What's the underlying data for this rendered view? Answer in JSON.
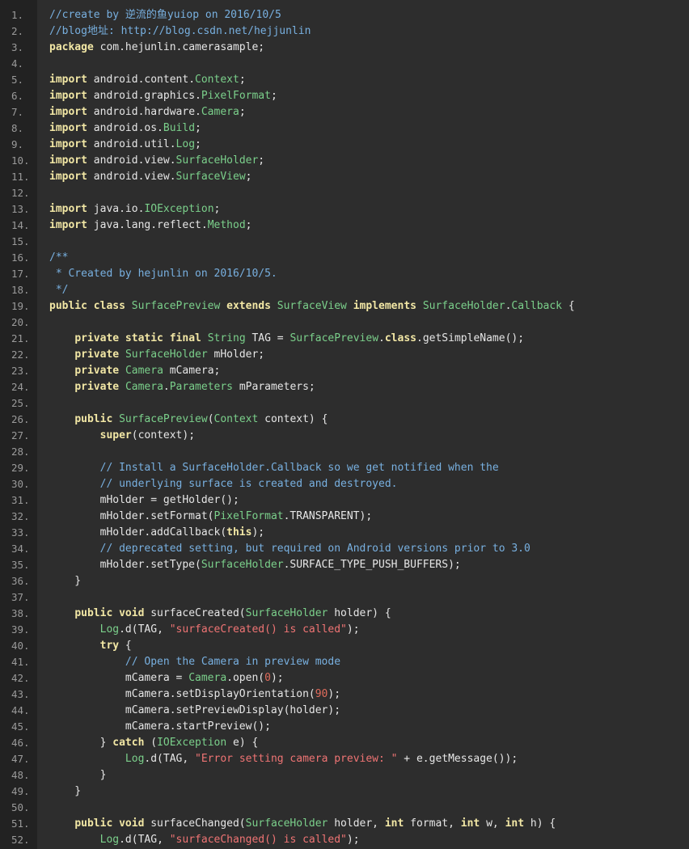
{
  "colors": {
    "gutter_background": "#222222",
    "code_background": "#2d2d2d",
    "line_number": "#9a9a9a",
    "plain": "#e6e6e6",
    "keyword": "#f2e7a5",
    "type": "#7bd08b",
    "comment": "#78b0e0",
    "string": "#ef7474",
    "number": "#e06c5c"
  },
  "code": {
    "lines": [
      {
        "number": "1.",
        "tokens": [
          {
            "t": "cm",
            "v": "//create by 逆流的鱼yuiop on 2016/10/5"
          }
        ]
      },
      {
        "number": "2.",
        "tokens": [
          {
            "t": "cm",
            "v": "//blog地址: http://blog.csdn.net/hejjunlin"
          }
        ]
      },
      {
        "number": "3.",
        "tokens": [
          {
            "t": "kw",
            "v": "package"
          },
          {
            "t": "pl",
            "v": " com.hejunlin.camerasample;"
          }
        ]
      },
      {
        "number": "4.",
        "tokens": []
      },
      {
        "number": "5.",
        "tokens": [
          {
            "t": "kw",
            "v": "import"
          },
          {
            "t": "pl",
            "v": " android.content."
          },
          {
            "t": "ty",
            "v": "Context"
          },
          {
            "t": "pl",
            "v": ";"
          }
        ]
      },
      {
        "number": "6.",
        "tokens": [
          {
            "t": "kw",
            "v": "import"
          },
          {
            "t": "pl",
            "v": " android.graphics."
          },
          {
            "t": "ty",
            "v": "PixelFormat"
          },
          {
            "t": "pl",
            "v": ";"
          }
        ]
      },
      {
        "number": "7.",
        "tokens": [
          {
            "t": "kw",
            "v": "import"
          },
          {
            "t": "pl",
            "v": " android.hardware."
          },
          {
            "t": "ty",
            "v": "Camera"
          },
          {
            "t": "pl",
            "v": ";"
          }
        ]
      },
      {
        "number": "8.",
        "tokens": [
          {
            "t": "kw",
            "v": "import"
          },
          {
            "t": "pl",
            "v": " android.os."
          },
          {
            "t": "ty",
            "v": "Build"
          },
          {
            "t": "pl",
            "v": ";"
          }
        ]
      },
      {
        "number": "9.",
        "tokens": [
          {
            "t": "kw",
            "v": "import"
          },
          {
            "t": "pl",
            "v": " android.util."
          },
          {
            "t": "ty",
            "v": "Log"
          },
          {
            "t": "pl",
            "v": ";"
          }
        ]
      },
      {
        "number": "10.",
        "tokens": [
          {
            "t": "kw",
            "v": "import"
          },
          {
            "t": "pl",
            "v": " android.view."
          },
          {
            "t": "ty",
            "v": "SurfaceHolder"
          },
          {
            "t": "pl",
            "v": ";"
          }
        ]
      },
      {
        "number": "11.",
        "tokens": [
          {
            "t": "kw",
            "v": "import"
          },
          {
            "t": "pl",
            "v": " android.view."
          },
          {
            "t": "ty",
            "v": "SurfaceView"
          },
          {
            "t": "pl",
            "v": ";"
          }
        ]
      },
      {
        "number": "12.",
        "tokens": []
      },
      {
        "number": "13.",
        "tokens": [
          {
            "t": "kw",
            "v": "import"
          },
          {
            "t": "pl",
            "v": " java.io."
          },
          {
            "t": "ty",
            "v": "IOException"
          },
          {
            "t": "pl",
            "v": ";"
          }
        ]
      },
      {
        "number": "14.",
        "tokens": [
          {
            "t": "kw",
            "v": "import"
          },
          {
            "t": "pl",
            "v": " java.lang.reflect."
          },
          {
            "t": "ty",
            "v": "Method"
          },
          {
            "t": "pl",
            "v": ";"
          }
        ]
      },
      {
        "number": "15.",
        "tokens": []
      },
      {
        "number": "16.",
        "tokens": [
          {
            "t": "cm",
            "v": "/**"
          }
        ]
      },
      {
        "number": "17.",
        "tokens": [
          {
            "t": "cm",
            "v": " * Created by hejunlin on 2016/10/5."
          }
        ]
      },
      {
        "number": "18.",
        "tokens": [
          {
            "t": "cm",
            "v": " */"
          }
        ]
      },
      {
        "number": "19.",
        "tokens": [
          {
            "t": "kw",
            "v": "public class"
          },
          {
            "t": "pl",
            "v": " "
          },
          {
            "t": "ty",
            "v": "SurfacePreview"
          },
          {
            "t": "pl",
            "v": " "
          },
          {
            "t": "kw",
            "v": "extends"
          },
          {
            "t": "pl",
            "v": " "
          },
          {
            "t": "ty",
            "v": "SurfaceView"
          },
          {
            "t": "pl",
            "v": " "
          },
          {
            "t": "kw",
            "v": "implements"
          },
          {
            "t": "pl",
            "v": " "
          },
          {
            "t": "ty",
            "v": "SurfaceHolder"
          },
          {
            "t": "pl",
            "v": "."
          },
          {
            "t": "ty",
            "v": "Callback"
          },
          {
            "t": "pl",
            "v": " {"
          }
        ]
      },
      {
        "number": "20.",
        "tokens": []
      },
      {
        "number": "21.",
        "tokens": [
          {
            "t": "pl",
            "v": "    "
          },
          {
            "t": "kw",
            "v": "private static final"
          },
          {
            "t": "pl",
            "v": " "
          },
          {
            "t": "ty",
            "v": "String"
          },
          {
            "t": "pl",
            "v": " TAG = "
          },
          {
            "t": "ty",
            "v": "SurfacePreview"
          },
          {
            "t": "pl",
            "v": "."
          },
          {
            "t": "kw",
            "v": "class"
          },
          {
            "t": "pl",
            "v": ".getSimpleName();"
          }
        ]
      },
      {
        "number": "22.",
        "tokens": [
          {
            "t": "pl",
            "v": "    "
          },
          {
            "t": "kw",
            "v": "private"
          },
          {
            "t": "pl",
            "v": " "
          },
          {
            "t": "ty",
            "v": "SurfaceHolder"
          },
          {
            "t": "pl",
            "v": " mHolder;"
          }
        ]
      },
      {
        "number": "23.",
        "tokens": [
          {
            "t": "pl",
            "v": "    "
          },
          {
            "t": "kw",
            "v": "private"
          },
          {
            "t": "pl",
            "v": " "
          },
          {
            "t": "ty",
            "v": "Camera"
          },
          {
            "t": "pl",
            "v": " mCamera;"
          }
        ]
      },
      {
        "number": "24.",
        "tokens": [
          {
            "t": "pl",
            "v": "    "
          },
          {
            "t": "kw",
            "v": "private"
          },
          {
            "t": "pl",
            "v": " "
          },
          {
            "t": "ty",
            "v": "Camera"
          },
          {
            "t": "pl",
            "v": "."
          },
          {
            "t": "ty",
            "v": "Parameters"
          },
          {
            "t": "pl",
            "v": " mParameters;"
          }
        ]
      },
      {
        "number": "25.",
        "tokens": []
      },
      {
        "number": "26.",
        "tokens": [
          {
            "t": "pl",
            "v": "    "
          },
          {
            "t": "kw",
            "v": "public"
          },
          {
            "t": "pl",
            "v": " "
          },
          {
            "t": "ty",
            "v": "SurfacePreview"
          },
          {
            "t": "pl",
            "v": "("
          },
          {
            "t": "ty",
            "v": "Context"
          },
          {
            "t": "pl",
            "v": " context) {"
          }
        ]
      },
      {
        "number": "27.",
        "tokens": [
          {
            "t": "pl",
            "v": "        "
          },
          {
            "t": "kw",
            "v": "super"
          },
          {
            "t": "pl",
            "v": "(context);"
          }
        ]
      },
      {
        "number": "28.",
        "tokens": []
      },
      {
        "number": "29.",
        "tokens": [
          {
            "t": "pl",
            "v": "        "
          },
          {
            "t": "cm",
            "v": "// Install a SurfaceHolder.Callback so we get notified when the"
          }
        ]
      },
      {
        "number": "30.",
        "tokens": [
          {
            "t": "pl",
            "v": "        "
          },
          {
            "t": "cm",
            "v": "// underlying surface is created and destroyed."
          }
        ]
      },
      {
        "number": "31.",
        "tokens": [
          {
            "t": "pl",
            "v": "        mHolder = getHolder();"
          }
        ]
      },
      {
        "number": "32.",
        "tokens": [
          {
            "t": "pl",
            "v": "        mHolder.setFormat("
          },
          {
            "t": "ty",
            "v": "PixelFormat"
          },
          {
            "t": "pl",
            "v": ".TRANSPARENT);"
          }
        ]
      },
      {
        "number": "33.",
        "tokens": [
          {
            "t": "pl",
            "v": "        mHolder.addCallback("
          },
          {
            "t": "kw",
            "v": "this"
          },
          {
            "t": "pl",
            "v": ");"
          }
        ]
      },
      {
        "number": "34.",
        "tokens": [
          {
            "t": "pl",
            "v": "        "
          },
          {
            "t": "cm",
            "v": "// deprecated setting, but required on Android versions prior to 3.0"
          }
        ]
      },
      {
        "number": "35.",
        "tokens": [
          {
            "t": "pl",
            "v": "        mHolder.setType("
          },
          {
            "t": "ty",
            "v": "SurfaceHolder"
          },
          {
            "t": "pl",
            "v": ".SURFACE_TYPE_PUSH_BUFFERS);"
          }
        ]
      },
      {
        "number": "36.",
        "tokens": [
          {
            "t": "pl",
            "v": "    }"
          }
        ]
      },
      {
        "number": "37.",
        "tokens": []
      },
      {
        "number": "38.",
        "tokens": [
          {
            "t": "pl",
            "v": "    "
          },
          {
            "t": "kw",
            "v": "public void"
          },
          {
            "t": "pl",
            "v": " surfaceCreated("
          },
          {
            "t": "ty",
            "v": "SurfaceHolder"
          },
          {
            "t": "pl",
            "v": " holder) {"
          }
        ]
      },
      {
        "number": "39.",
        "tokens": [
          {
            "t": "pl",
            "v": "        "
          },
          {
            "t": "ty",
            "v": "Log"
          },
          {
            "t": "pl",
            "v": ".d(TAG, "
          },
          {
            "t": "st",
            "v": "\"surfaceCreated() is called\""
          },
          {
            "t": "pl",
            "v": ");"
          }
        ]
      },
      {
        "number": "40.",
        "tokens": [
          {
            "t": "pl",
            "v": "        "
          },
          {
            "t": "kw",
            "v": "try"
          },
          {
            "t": "pl",
            "v": " {"
          }
        ]
      },
      {
        "number": "41.",
        "tokens": [
          {
            "t": "pl",
            "v": "            "
          },
          {
            "t": "cm",
            "v": "// Open the Camera in preview mode"
          }
        ]
      },
      {
        "number": "42.",
        "tokens": [
          {
            "t": "pl",
            "v": "            mCamera = "
          },
          {
            "t": "ty",
            "v": "Camera"
          },
          {
            "t": "pl",
            "v": ".open("
          },
          {
            "t": "nu",
            "v": "0"
          },
          {
            "t": "pl",
            "v": ");"
          }
        ]
      },
      {
        "number": "43.",
        "tokens": [
          {
            "t": "pl",
            "v": "            mCamera.setDisplayOrientation("
          },
          {
            "t": "nu",
            "v": "90"
          },
          {
            "t": "pl",
            "v": ");"
          }
        ]
      },
      {
        "number": "44.",
        "tokens": [
          {
            "t": "pl",
            "v": "            mCamera.setPreviewDisplay(holder);"
          }
        ]
      },
      {
        "number": "45.",
        "tokens": [
          {
            "t": "pl",
            "v": "            mCamera.startPreview();"
          }
        ]
      },
      {
        "number": "46.",
        "tokens": [
          {
            "t": "pl",
            "v": "        } "
          },
          {
            "t": "kw",
            "v": "catch"
          },
          {
            "t": "pl",
            "v": " ("
          },
          {
            "t": "ty",
            "v": "IOException"
          },
          {
            "t": "pl",
            "v": " e) {"
          }
        ]
      },
      {
        "number": "47.",
        "tokens": [
          {
            "t": "pl",
            "v": "            "
          },
          {
            "t": "ty",
            "v": "Log"
          },
          {
            "t": "pl",
            "v": ".d(TAG, "
          },
          {
            "t": "st",
            "v": "\"Error setting camera preview: \""
          },
          {
            "t": "pl",
            "v": " + e.getMessage());"
          }
        ]
      },
      {
        "number": "48.",
        "tokens": [
          {
            "t": "pl",
            "v": "        }"
          }
        ]
      },
      {
        "number": "49.",
        "tokens": [
          {
            "t": "pl",
            "v": "    }"
          }
        ]
      },
      {
        "number": "50.",
        "tokens": []
      },
      {
        "number": "51.",
        "tokens": [
          {
            "t": "pl",
            "v": "    "
          },
          {
            "t": "kw",
            "v": "public void"
          },
          {
            "t": "pl",
            "v": " surfaceChanged("
          },
          {
            "t": "ty",
            "v": "SurfaceHolder"
          },
          {
            "t": "pl",
            "v": " holder, "
          },
          {
            "t": "kw",
            "v": "int"
          },
          {
            "t": "pl",
            "v": " format, "
          },
          {
            "t": "kw",
            "v": "int"
          },
          {
            "t": "pl",
            "v": " w, "
          },
          {
            "t": "kw",
            "v": "int"
          },
          {
            "t": "pl",
            "v": " h) {"
          }
        ]
      },
      {
        "number": "52.",
        "tokens": [
          {
            "t": "pl",
            "v": "        "
          },
          {
            "t": "ty",
            "v": "Log"
          },
          {
            "t": "pl",
            "v": ".d(TAG, "
          },
          {
            "t": "st",
            "v": "\"surfaceChanged() is called\""
          },
          {
            "t": "pl",
            "v": ");"
          }
        ]
      }
    ]
  }
}
